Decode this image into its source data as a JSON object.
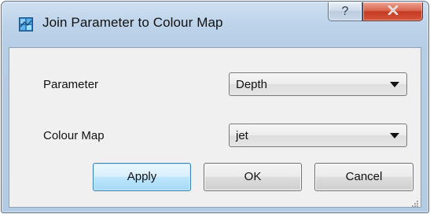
{
  "window": {
    "title": "Join Parameter to Colour Map",
    "help_glyph": "?",
    "app_icon": "map-icon",
    "close_icon": "close-icon"
  },
  "form": {
    "parameter_label": "Parameter",
    "parameter_value": "Depth",
    "colourmap_label": "Colour Map",
    "colourmap_value": "jet"
  },
  "buttons": {
    "apply": "Apply",
    "ok": "OK",
    "cancel": "Cancel"
  },
  "colors": {
    "frame": "#b6cde6",
    "close_button": "#c43b22",
    "default_button_border": "#3c7fb1"
  }
}
